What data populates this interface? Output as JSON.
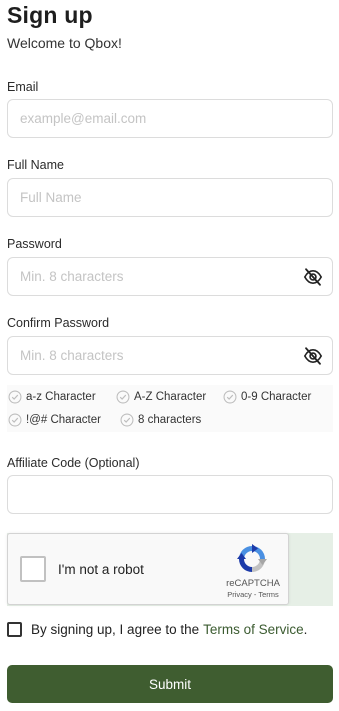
{
  "header": {
    "title": "Sign up",
    "subtitle": "Welcome to Qbox!"
  },
  "form": {
    "email": {
      "label": "Email",
      "placeholder": "example@email.com",
      "value": ""
    },
    "full_name": {
      "label": "Full Name",
      "placeholder": "Full Name",
      "value": ""
    },
    "password": {
      "label": "Password",
      "placeholder": "Min. 8 characters",
      "value": "",
      "toggle_icon": "eye-slash-icon"
    },
    "confirm_password": {
      "label": "Confirm Password",
      "placeholder": "Min. 8 characters",
      "value": "",
      "toggle_icon": "eye-slash-icon"
    },
    "password_rules": [
      {
        "label": "a-z Character",
        "met": false
      },
      {
        "label": "A-Z Character",
        "met": false
      },
      {
        "label": "0-9 Character",
        "met": false
      },
      {
        "label": "!@# Character",
        "met": false
      },
      {
        "label": "8 characters",
        "met": false
      }
    ],
    "affiliate": {
      "label": "Affiliate Code (Optional)",
      "placeholder": "",
      "value": ""
    }
  },
  "captcha": {
    "checkbox_label": "I'm not a robot",
    "brand": "reCAPTCHA",
    "privacy_label": "Privacy",
    "separator": " - ",
    "terms_label": "Terms",
    "checked": false
  },
  "agreement": {
    "text": "By signing up, I agree to the",
    "link_label": "Terms of Service",
    "suffix": ".",
    "checked": false
  },
  "submit": {
    "label": "Submit"
  },
  "colors": {
    "primary": "#3f5d30",
    "link": "#3b5b30",
    "input_border": "#dcdcdc",
    "placeholder": "#c4c4c4",
    "captcha_background": "#e6efe6"
  }
}
